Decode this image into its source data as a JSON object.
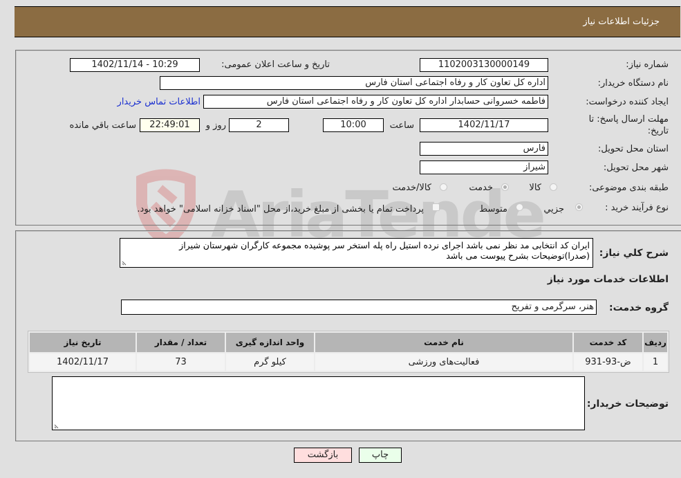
{
  "header": {
    "title": "جزئیات اطلاعات نیاز"
  },
  "form": {
    "need_number_label": "شماره نیاز:",
    "need_number": "1102003130000149",
    "announce_label": "تاریخ و ساعت اعلان عمومی:",
    "announce_value": "1402/11/14 - 10:29",
    "buyer_org_label": "نام دستگاه خریدار:",
    "buyer_org": "اداره کل تعاون  کار و رفاه اجتماعی استان فارس",
    "creator_label": "ایجاد کننده درخواست:",
    "creator": "فاطمه خسروانی حسابدار اداره کل تعاون  کار و رفاه اجتماعی استان فارس",
    "contact_link": "اطلاعات تماس خریدار",
    "deadline_label": "مهلت ارسال پاسخ: تا تاریخ:",
    "deadline_date": "1402/11/17",
    "time_label": "ساعت",
    "deadline_time": "10:00",
    "days_value": "2",
    "days_label": "روز و",
    "remaining_time": "22:49:01",
    "remaining_label": "ساعت باقي مانده",
    "province_label": "استان محل تحویل:",
    "province": "فارس",
    "city_label": "شهر محل تحویل:",
    "city": "شیراز",
    "category_label": "طبقه بندی موضوعی:",
    "category_options": [
      "کالا",
      "خدمت",
      "کالا/خدمت"
    ],
    "category_selected": "خدمت",
    "purchase_type_label": "نوع فرآیند خرید :",
    "purchase_type_options": [
      "جزيي",
      "متوسط"
    ],
    "purchase_type_selected": "جزيي",
    "treasury_note": "پرداخت تمام یا بخشی از مبلغ خرید،از محل \"اسناد خزانه اسلامی\" خواهد بود."
  },
  "details": {
    "description_label": "شرح کلي نیاز:",
    "description": "ایران کد انتخابی مد نظر نمی باشد اجرای نرده استیل راه پله استخر سر پوشیده مجموعه کارگران شهرستان شیراز (صدرا)توضیحات بشرح پیوست می باشد",
    "services_title": "اطلاعات خدمات مورد نیاز",
    "service_group_label": "گروه خدمت:",
    "service_group": "هنر، سرگرمی و تفریح",
    "table": {
      "headers": [
        "ردیف",
        "کد خدمت",
        "نام خدمت",
        "واحد اندازه گیری",
        "تعداد / مقدار",
        "تاریخ نیاز"
      ],
      "rows": [
        [
          "1",
          "ض-93-931",
          "فعالیت‌های ورزشی",
          "کیلو گرم",
          "73",
          "1402/11/17"
        ]
      ]
    },
    "buyer_notes_label": "توضیحات خریدار:",
    "buyer_notes": ""
  },
  "buttons": {
    "print": "چاپ",
    "back": "بازگشت"
  },
  "watermark": {
    "text": "AriaTender.neT"
  },
  "colors": {
    "header_bg": "#8b6c42",
    "print_bg": "#eaffea",
    "back_bg": "#ffdede",
    "link": "#1a2fd0"
  }
}
